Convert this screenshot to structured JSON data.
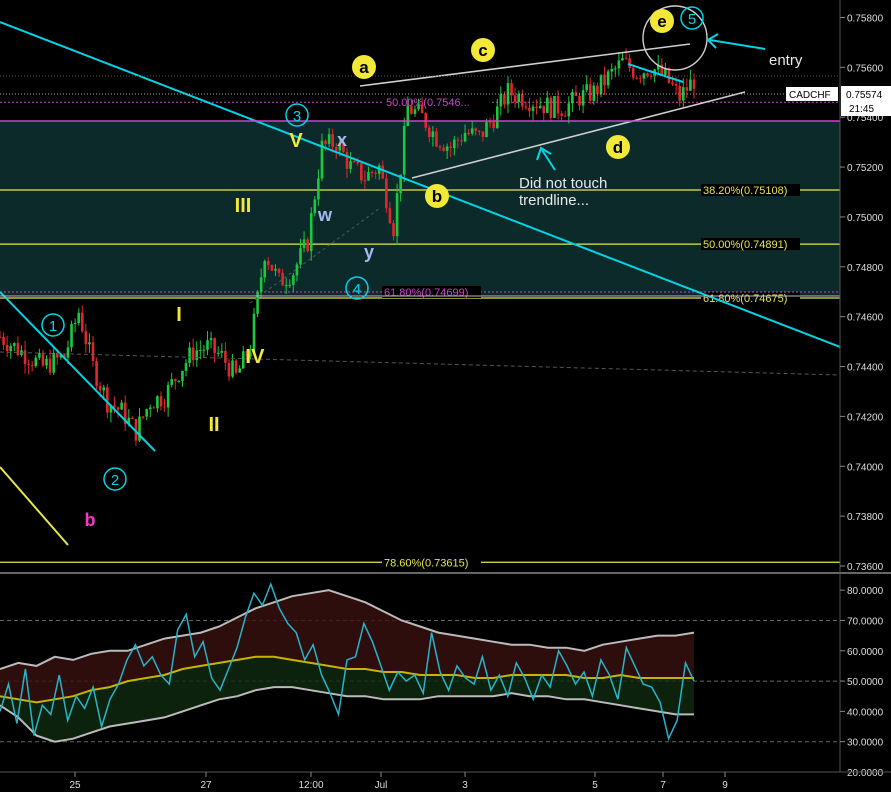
{
  "symbol": "CADCHF",
  "last_price": "0.75574",
  "countdown": "21:45",
  "colors": {
    "background": "#000000",
    "candle_up": "#19c940",
    "candle_down": "#e0262e",
    "trendline_cyan": "#00d4e6",
    "fib_yellow": "#e6e64a",
    "fib_magenta": "#cc44cc",
    "label_yellow": "#f2e83a",
    "label_blue": "#a6b8f2",
    "label_magenta": "#ff33cc",
    "zone_fill": "#0d2a2a",
    "channel_white": "#cfcfcf",
    "indicator_line": "#28b4c8",
    "indicator_mid": "#c8b400"
  },
  "chart_data": [
    {
      "type": "candlestick",
      "symbol": "CADCHF",
      "x_tick_labels": [
        "25",
        "27",
        "12:00",
        "Jul",
        "3",
        "5",
        "7",
        "9"
      ],
      "y_tick_labels": [
        "0.75800",
        "0.75600",
        "0.75400",
        "0.75200",
        "0.75000",
        "0.74800",
        "0.74600",
        "0.74400",
        "0.74200",
        "0.74000",
        "0.73800",
        "0.73600"
      ],
      "ylim": [
        0.7358,
        0.7587
      ],
      "grid": false,
      "fib_levels": [
        {
          "label": "38.20%(0.75108)",
          "value": 0.75108,
          "color": "yellow"
        },
        {
          "label": "50.00%(0.74891)",
          "value": 0.74891,
          "color": "yellow"
        },
        {
          "label": "61.80%(0.74675)",
          "value": 0.74675,
          "color": "yellow"
        },
        {
          "label": "78.60%(0.73615)",
          "value": 0.73615,
          "color": "yellow"
        },
        {
          "label": "50.00%(0.7546...",
          "value": 0.7546,
          "color": "magenta"
        },
        {
          "label": "61.80%(0.74699)",
          "value": 0.74699,
          "color": "magenta"
        }
      ],
      "wave_labels": [
        "1",
        "2",
        "3",
        "4",
        "5",
        "I",
        "II",
        "III",
        "IV",
        "V",
        "a",
        "b",
        "c",
        "d",
        "e",
        "w",
        "x",
        "y",
        "b"
      ],
      "annotations": [
        "Did not touch",
        "trendline...",
        "entry"
      ],
      "approximate_close_path": [
        [
          0,
          0.7452
        ],
        [
          6,
          0.7446
        ],
        [
          12,
          0.744
        ],
        [
          18,
          0.7444
        ],
        [
          22,
          0.7462
        ],
        [
          26,
          0.744
        ],
        [
          30,
          0.7426
        ],
        [
          34,
          0.7422
        ],
        [
          38,
          0.7414
        ],
        [
          42,
          0.7426
        ],
        [
          46,
          0.7428
        ],
        [
          50,
          0.7438
        ],
        [
          54,
          0.7446
        ],
        [
          58,
          0.7448
        ],
        [
          62,
          0.7444
        ],
        [
          66,
          0.7436
        ],
        [
          70,
          0.7448
        ],
        [
          74,
          0.7486
        ],
        [
          78,
          0.7474
        ],
        [
          82,
          0.7478
        ],
        [
          86,
          0.749
        ],
        [
          90,
          0.7528
        ],
        [
          94,
          0.753
        ],
        [
          98,
          0.752
        ],
        [
          102,
          0.7516
        ],
        [
          106,
          0.752
        ],
        [
          110,
          0.7496
        ],
        [
          114,
          0.7544
        ],
        [
          118,
          0.754
        ],
        [
          122,
          0.7532
        ],
        [
          126,
          0.7528
        ],
        [
          130,
          0.7534
        ],
        [
          134,
          0.7532
        ],
        [
          138,
          0.754
        ],
        [
          142,
          0.755
        ],
        [
          146,
          0.7548
        ],
        [
          150,
          0.7546
        ],
        [
          154,
          0.7544
        ],
        [
          158,
          0.7544
        ],
        [
          162,
          0.7548
        ],
        [
          166,
          0.755
        ],
        [
          170,
          0.7556
        ],
        [
          174,
          0.7562
        ],
        [
          178,
          0.7558
        ],
        [
          182,
          0.756
        ],
        [
          186,
          0.7556
        ],
        [
          190,
          0.7548
        ],
        [
          194,
          0.7555
        ]
      ]
    },
    {
      "type": "line",
      "name": "oscillator",
      "y_tick_labels": [
        "80.0000",
        "70.0000",
        "60.0000",
        "50.0000",
        "40.0000",
        "30.0000",
        "20.0000"
      ],
      "ylim": [
        20,
        85
      ],
      "reference_levels": [
        70,
        50,
        30
      ],
      "values": [
        40,
        49,
        36,
        54,
        32,
        42,
        39,
        52,
        37,
        45,
        41,
        48,
        35,
        44,
        49,
        57,
        62,
        55,
        58,
        52,
        49,
        67,
        72,
        58,
        63,
        51,
        47,
        54,
        61,
        71,
        79,
        75,
        82,
        74,
        69,
        66,
        57,
        62,
        52,
        46,
        39,
        57,
        58,
        69,
        63,
        55,
        47,
        53,
        50,
        52,
        46,
        66,
        53,
        47,
        55,
        51,
        49,
        58,
        47,
        52,
        45,
        56,
        51,
        44,
        52,
        48,
        60,
        55,
        49,
        53,
        45,
        57,
        52,
        44,
        61,
        55,
        49,
        48,
        43,
        31,
        37,
        56,
        50
      ],
      "band_upper": [
        54,
        56,
        55,
        58,
        57,
        59,
        60,
        60,
        62,
        64,
        65,
        66,
        68,
        71,
        74,
        76,
        78,
        79,
        80,
        78,
        76,
        73,
        70,
        68,
        66,
        65,
        64,
        63,
        62,
        62,
        61,
        61,
        60,
        62,
        63,
        64,
        65,
        65,
        66
      ],
      "band_lower": [
        42,
        38,
        32,
        30,
        31,
        33,
        35,
        36,
        37,
        38,
        40,
        42,
        44,
        45,
        47,
        48,
        48,
        47,
        46,
        45,
        45,
        44,
        44,
        44,
        45,
        45,
        45,
        45,
        46,
        45,
        45,
        44,
        44,
        43,
        42,
        41,
        40,
        39,
        39
      ],
      "middle": [
        45,
        44,
        43,
        44,
        45,
        47,
        48,
        50,
        51,
        52,
        54,
        55,
        56,
        57,
        58,
        58,
        57,
        56,
        55,
        54,
        54,
        53,
        53,
        52,
        52,
        52,
        51,
        51,
        52,
        52,
        52,
        52,
        51,
        51,
        52,
        51,
        51,
        51,
        51
      ]
    }
  ]
}
